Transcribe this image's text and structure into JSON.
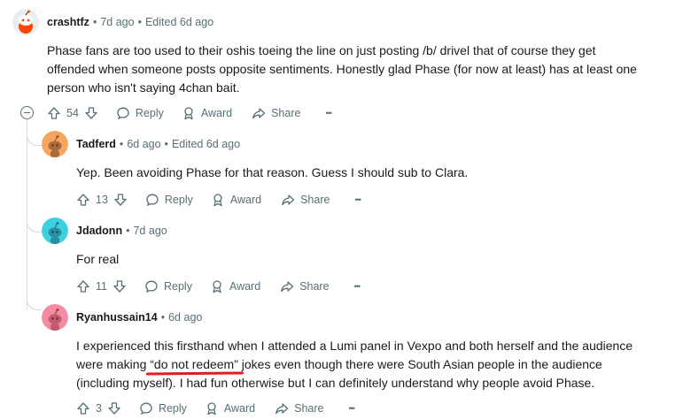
{
  "comments": [
    {
      "user": "crashtfz",
      "age": "7d ago",
      "edited": "Edited 6d ago",
      "lines": [
        "Phase fans are too used to their oshis toeing the line on just posting /b/ drivel that of course they get",
        "offended when someone posts opposite sentiments. Honestly glad Phase (for now at least) has at least one",
        "person who isn't saying 4chan bait."
      ],
      "score": "54",
      "avatar_color": "#ff4500"
    },
    {
      "user": "Tadferd",
      "age": "6d ago",
      "edited": "Edited 6d ago",
      "lines": [
        "Yep. Been avoiding Phase for that reason. Guess I should sub to Clara."
      ],
      "score": "13",
      "avatar_color": "#f6a55f"
    },
    {
      "user": "Jdadonn",
      "age": "7d ago",
      "lines": [
        "For real"
      ],
      "score": "11",
      "avatar_color": "#3fd0e0"
    },
    {
      "user": "Ryanhussain14",
      "age": "6d ago",
      "lines": [
        "I experienced this firsthand when I attended a Lumi panel in Vexpo and both herself and the audience",
        "were making ",
        "“do not redeem”",
        " jokes even though there were South Asian people in the audience",
        "(including myself). I had fun otherwise but I can definitely understand why people avoid Phase."
      ],
      "score": "3",
      "avatar_color": "#f38ca0"
    }
  ],
  "labels": {
    "reply": "Reply",
    "award": "Award",
    "share": "Share",
    "more": "•••",
    "dot": "•"
  },
  "colors": {
    "meta": "#576f76",
    "annotation": "#e01b24"
  }
}
